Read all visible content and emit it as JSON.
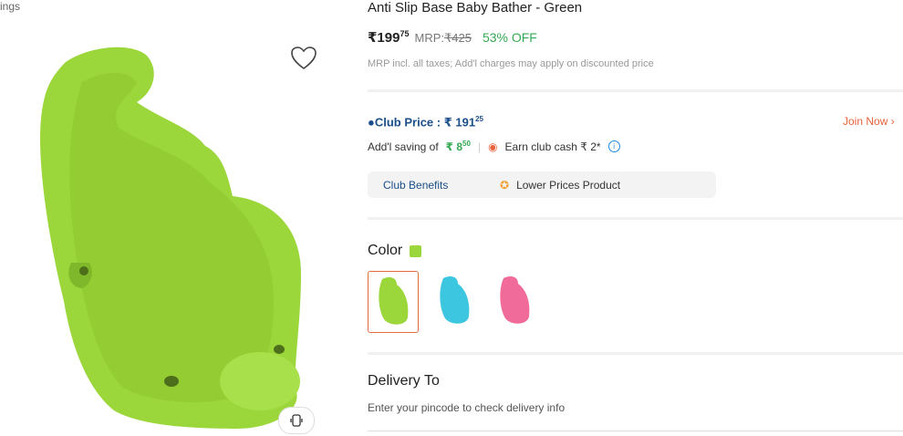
{
  "breadcrumb": {
    "text": "ings"
  },
  "product": {
    "title": "Anti Slip Base Baby Bather - Green",
    "price": {
      "main": "₹199",
      "paise": "75",
      "mrp_label": "MRP:",
      "mrp_value": "₹425",
      "discount": "53% OFF"
    },
    "tax_note": "MRP incl. all taxes; Add'l charges may apply on discounted price"
  },
  "club": {
    "price_label": "Club Price : ₹ 191",
    "price_paise": "25",
    "join_label": "Join Now",
    "saving_label": "Add'l saving of",
    "saving_value": "₹ 8",
    "saving_paise": "50",
    "earn_label": "Earn club cash ₹ 2*",
    "benefits_label": "Club Benefits",
    "benefits_value": "Lower Prices Product"
  },
  "color": {
    "label": "Color",
    "selected_color": "#9bd63a",
    "options": [
      {
        "name": "green",
        "color": "#9bd63a"
      },
      {
        "name": "blue",
        "color": "#3cc6e0"
      },
      {
        "name": "pink",
        "color": "#f06a9a"
      }
    ]
  },
  "delivery": {
    "title": "Delivery To",
    "note": "Enter your pincode to check delivery info"
  }
}
